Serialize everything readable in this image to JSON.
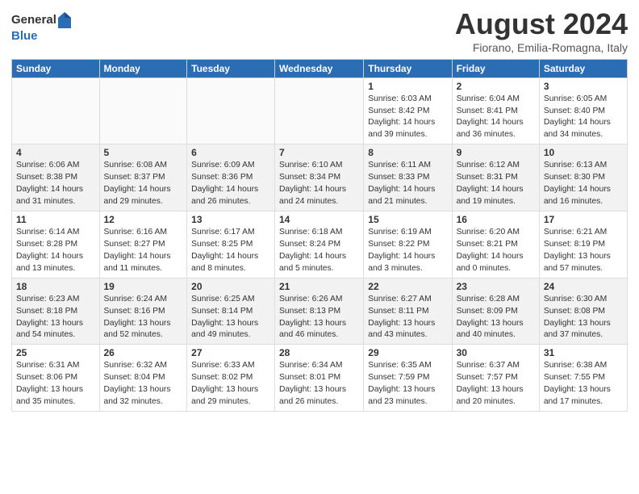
{
  "header": {
    "logo_general": "General",
    "logo_blue": "Blue",
    "month": "August 2024",
    "location": "Fiorano, Emilia-Romagna, Italy"
  },
  "days_of_week": [
    "Sunday",
    "Monday",
    "Tuesday",
    "Wednesday",
    "Thursday",
    "Friday",
    "Saturday"
  ],
  "weeks": [
    [
      {
        "day": "",
        "info": ""
      },
      {
        "day": "",
        "info": ""
      },
      {
        "day": "",
        "info": ""
      },
      {
        "day": "",
        "info": ""
      },
      {
        "day": "1",
        "info": "Sunrise: 6:03 AM\nSunset: 8:42 PM\nDaylight: 14 hours\nand 39 minutes."
      },
      {
        "day": "2",
        "info": "Sunrise: 6:04 AM\nSunset: 8:41 PM\nDaylight: 14 hours\nand 36 minutes."
      },
      {
        "day": "3",
        "info": "Sunrise: 6:05 AM\nSunset: 8:40 PM\nDaylight: 14 hours\nand 34 minutes."
      }
    ],
    [
      {
        "day": "4",
        "info": "Sunrise: 6:06 AM\nSunset: 8:38 PM\nDaylight: 14 hours\nand 31 minutes."
      },
      {
        "day": "5",
        "info": "Sunrise: 6:08 AM\nSunset: 8:37 PM\nDaylight: 14 hours\nand 29 minutes."
      },
      {
        "day": "6",
        "info": "Sunrise: 6:09 AM\nSunset: 8:36 PM\nDaylight: 14 hours\nand 26 minutes."
      },
      {
        "day": "7",
        "info": "Sunrise: 6:10 AM\nSunset: 8:34 PM\nDaylight: 14 hours\nand 24 minutes."
      },
      {
        "day": "8",
        "info": "Sunrise: 6:11 AM\nSunset: 8:33 PM\nDaylight: 14 hours\nand 21 minutes."
      },
      {
        "day": "9",
        "info": "Sunrise: 6:12 AM\nSunset: 8:31 PM\nDaylight: 14 hours\nand 19 minutes."
      },
      {
        "day": "10",
        "info": "Sunrise: 6:13 AM\nSunset: 8:30 PM\nDaylight: 14 hours\nand 16 minutes."
      }
    ],
    [
      {
        "day": "11",
        "info": "Sunrise: 6:14 AM\nSunset: 8:28 PM\nDaylight: 14 hours\nand 13 minutes."
      },
      {
        "day": "12",
        "info": "Sunrise: 6:16 AM\nSunset: 8:27 PM\nDaylight: 14 hours\nand 11 minutes."
      },
      {
        "day": "13",
        "info": "Sunrise: 6:17 AM\nSunset: 8:25 PM\nDaylight: 14 hours\nand 8 minutes."
      },
      {
        "day": "14",
        "info": "Sunrise: 6:18 AM\nSunset: 8:24 PM\nDaylight: 14 hours\nand 5 minutes."
      },
      {
        "day": "15",
        "info": "Sunrise: 6:19 AM\nSunset: 8:22 PM\nDaylight: 14 hours\nand 3 minutes."
      },
      {
        "day": "16",
        "info": "Sunrise: 6:20 AM\nSunset: 8:21 PM\nDaylight: 14 hours\nand 0 minutes."
      },
      {
        "day": "17",
        "info": "Sunrise: 6:21 AM\nSunset: 8:19 PM\nDaylight: 13 hours\nand 57 minutes."
      }
    ],
    [
      {
        "day": "18",
        "info": "Sunrise: 6:23 AM\nSunset: 8:18 PM\nDaylight: 13 hours\nand 54 minutes."
      },
      {
        "day": "19",
        "info": "Sunrise: 6:24 AM\nSunset: 8:16 PM\nDaylight: 13 hours\nand 52 minutes."
      },
      {
        "day": "20",
        "info": "Sunrise: 6:25 AM\nSunset: 8:14 PM\nDaylight: 13 hours\nand 49 minutes."
      },
      {
        "day": "21",
        "info": "Sunrise: 6:26 AM\nSunset: 8:13 PM\nDaylight: 13 hours\nand 46 minutes."
      },
      {
        "day": "22",
        "info": "Sunrise: 6:27 AM\nSunset: 8:11 PM\nDaylight: 13 hours\nand 43 minutes."
      },
      {
        "day": "23",
        "info": "Sunrise: 6:28 AM\nSunset: 8:09 PM\nDaylight: 13 hours\nand 40 minutes."
      },
      {
        "day": "24",
        "info": "Sunrise: 6:30 AM\nSunset: 8:08 PM\nDaylight: 13 hours\nand 37 minutes."
      }
    ],
    [
      {
        "day": "25",
        "info": "Sunrise: 6:31 AM\nSunset: 8:06 PM\nDaylight: 13 hours\nand 35 minutes."
      },
      {
        "day": "26",
        "info": "Sunrise: 6:32 AM\nSunset: 8:04 PM\nDaylight: 13 hours\nand 32 minutes."
      },
      {
        "day": "27",
        "info": "Sunrise: 6:33 AM\nSunset: 8:02 PM\nDaylight: 13 hours\nand 29 minutes."
      },
      {
        "day": "28",
        "info": "Sunrise: 6:34 AM\nSunset: 8:01 PM\nDaylight: 13 hours\nand 26 minutes."
      },
      {
        "day": "29",
        "info": "Sunrise: 6:35 AM\nSunset: 7:59 PM\nDaylight: 13 hours\nand 23 minutes."
      },
      {
        "day": "30",
        "info": "Sunrise: 6:37 AM\nSunset: 7:57 PM\nDaylight: 13 hours\nand 20 minutes."
      },
      {
        "day": "31",
        "info": "Sunrise: 6:38 AM\nSunset: 7:55 PM\nDaylight: 13 hours\nand 17 minutes."
      }
    ]
  ]
}
